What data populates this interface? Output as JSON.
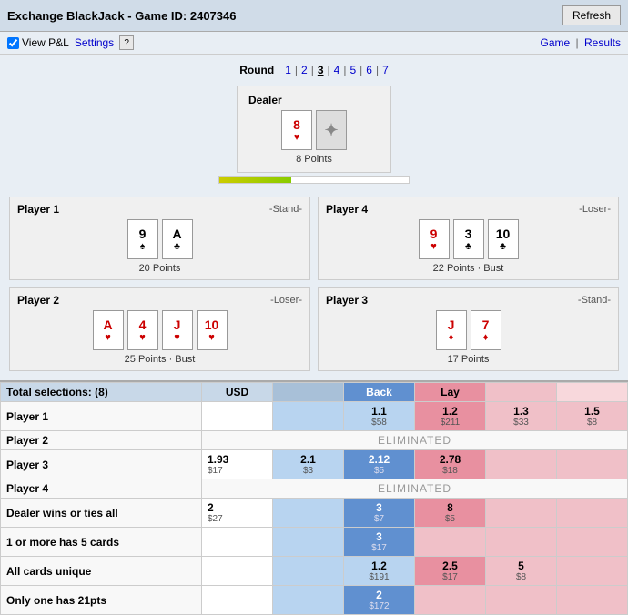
{
  "header": {
    "title": "Exchange BlackJack - Game ID: 2407346",
    "refresh_label": "Refresh"
  },
  "sub_header": {
    "view_pnl_label": "View P&L",
    "settings_label": "Settings",
    "help_label": "?",
    "game_link": "Game",
    "results_link": "Results"
  },
  "round": {
    "label": "Round",
    "numbers": [
      "1",
      "2",
      "3",
      "4",
      "5",
      "6",
      "7"
    ],
    "active": "3"
  },
  "dealer": {
    "label": "Dealer",
    "cards": [
      {
        "value": "8",
        "suit": "♥",
        "color": "red"
      },
      {
        "value": "back",
        "suit": "",
        "color": "gray"
      }
    ],
    "points": "8 Points"
  },
  "progress": {
    "width_pct": 38
  },
  "players": [
    {
      "id": "p1",
      "name": "Player 1",
      "status": "-Stand-",
      "cards": [
        {
          "value": "9",
          "suit": "♠",
          "color": "black"
        },
        {
          "value": "A",
          "suit": "♣",
          "color": "black"
        }
      ],
      "points": "20 Points",
      "position": "top-left"
    },
    {
      "id": "p4",
      "name": "Player 4",
      "status": "-Loser-",
      "cards": [
        {
          "value": "9",
          "suit": "♥",
          "color": "red"
        },
        {
          "value": "3",
          "suit": "♣",
          "color": "black"
        },
        {
          "value": "10",
          "suit": "♣",
          "color": "black"
        }
      ],
      "points": "22 Points · Bust",
      "position": "top-right"
    },
    {
      "id": "p2",
      "name": "Player 2",
      "status": "-Loser-",
      "cards": [
        {
          "value": "A",
          "suit": "♥",
          "color": "red"
        },
        {
          "value": "4",
          "suit": "♥",
          "color": "red"
        },
        {
          "value": "J",
          "suit": "♥",
          "color": "red"
        },
        {
          "value": "10",
          "suit": "♥",
          "color": "red"
        }
      ],
      "points": "25 Points · Bust",
      "position": "bottom-left"
    },
    {
      "id": "p3",
      "name": "Player 3",
      "status": "-Stand-",
      "cards": [
        {
          "value": "J",
          "suit": "♦",
          "color": "red"
        },
        {
          "value": "7",
          "suit": "♦",
          "color": "red"
        }
      ],
      "points": "17 Points",
      "position": "bottom-right"
    }
  ],
  "betting": {
    "total_selections": "Total selections: (8)",
    "col_usd": "USD",
    "col_back": "Back",
    "col_lay": "Lay",
    "rows": [
      {
        "type": "player",
        "name": "Player 1",
        "cells": [
          {
            "col": "back1",
            "odds": "",
            "stake": ""
          },
          {
            "col": "back2",
            "odds": "1.1",
            "stake": "$58",
            "style": "back"
          },
          {
            "col": "lay1",
            "odds": "1.2",
            "stake": "$211",
            "style": "lay-active"
          },
          {
            "col": "lay2",
            "odds": "1.3",
            "stake": "$33",
            "style": "lay"
          },
          {
            "col": "lay3",
            "odds": "1.5",
            "stake": "$8",
            "style": "lay"
          }
        ]
      },
      {
        "type": "eliminated",
        "name": "Player 2",
        "label": "ELIMINATED"
      },
      {
        "type": "player",
        "name": "Player 3",
        "cells": [
          {
            "col": "usd1",
            "odds": "1.93",
            "stake": "$17",
            "style": "normal"
          },
          {
            "col": "usd2",
            "odds": "2.1",
            "stake": "$3",
            "style": "normal"
          },
          {
            "col": "back1",
            "odds": "2.12",
            "stake": "$5",
            "style": "back-active"
          },
          {
            "col": "lay1",
            "odds": "2.78",
            "stake": "$18",
            "style": "lay-active"
          },
          {
            "col": "lay2",
            "odds": "",
            "stake": ""
          },
          {
            "col": "lay3",
            "odds": "",
            "stake": ""
          }
        ]
      },
      {
        "type": "eliminated",
        "name": "Player 4",
        "label": "ELIMINATED"
      },
      {
        "type": "special",
        "name": "Dealer wins or ties all",
        "cells": [
          {
            "odds": "2",
            "stake": "$27",
            "style": "normal"
          },
          {
            "odds": "3",
            "stake": "$7",
            "style": "back-active"
          },
          {
            "odds": "8",
            "stake": "$5",
            "style": "lay-active"
          },
          {
            "odds": "",
            "stake": ""
          },
          {
            "odds": "",
            "stake": ""
          }
        ]
      },
      {
        "type": "special",
        "name": "1 or more has 5 cards",
        "cells": [
          {
            "odds": "",
            "stake": ""
          },
          {
            "odds": "3",
            "stake": "$17",
            "style": "back-active"
          },
          {
            "odds": "",
            "stake": "",
            "style": "lay"
          },
          {
            "odds": "",
            "stake": ""
          },
          {
            "odds": "",
            "stake": ""
          }
        ]
      },
      {
        "type": "special",
        "name": "All cards unique",
        "cells": [
          {
            "odds": "",
            "stake": ""
          },
          {
            "odds": "1.2",
            "stake": "$191",
            "style": "back"
          },
          {
            "odds": "2.5",
            "stake": "$17",
            "style": "lay-active"
          },
          {
            "odds": "5",
            "stake": "$8",
            "style": "lay"
          },
          {
            "odds": "",
            "stake": ""
          }
        ]
      },
      {
        "type": "special",
        "name": "Only one has 21pts",
        "cells": [
          {
            "odds": "",
            "stake": ""
          },
          {
            "odds": "2",
            "stake": "$172",
            "style": "back-active"
          },
          {
            "odds": "",
            "stake": ""
          },
          {
            "odds": "",
            "stake": ""
          },
          {
            "odds": "",
            "stake": ""
          }
        ]
      }
    ]
  }
}
